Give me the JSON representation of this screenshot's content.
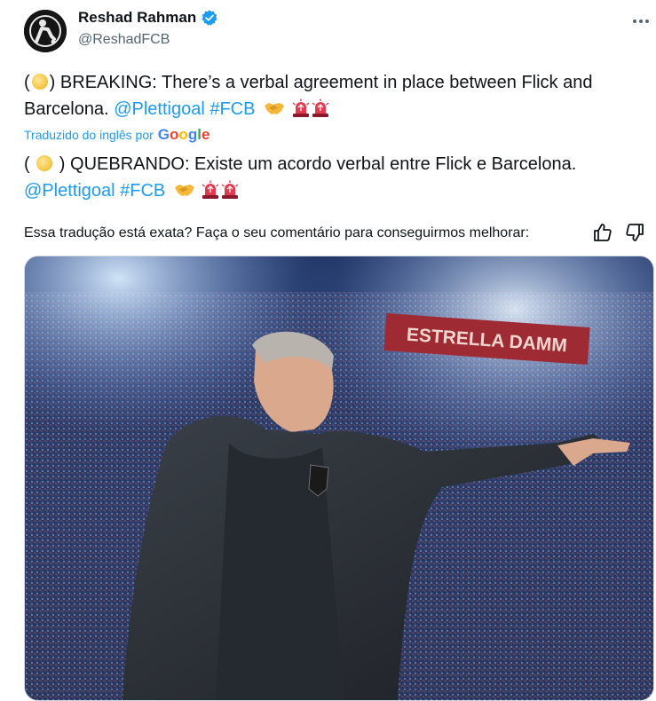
{
  "author": {
    "name": "Reshad Rahman",
    "handle": "@ReshadFCB"
  },
  "tweet": {
    "open_paren": "(",
    "close_paren": ")",
    "body": "BREAKING: There’s a verbal agreement in place between Flick and Barcelona.",
    "mention": "@Plettigoal",
    "hashtag": "#FCB"
  },
  "translation": {
    "translated_by": "Traduzido do inglês por",
    "provider": "Google",
    "open_paren": "(",
    "close_paren": ")",
    "body": "QUEBRANDO: Existe um acordo verbal entre Flick e Barcelona.",
    "mention": "@Plettigoal",
    "hashtag": "#FCB"
  },
  "feedback": {
    "prompt": "Essa tradução está exata? Faça o seu comentário para conseguirmos melhorar:"
  },
  "media": {
    "banner_text": "ESTRELLA DAMM"
  },
  "colors": {
    "link": "#1d9bf0",
    "verified": "#1d9bf0",
    "secondary_text": "#536471"
  },
  "icons": [
    "more-icon",
    "verified-badge-icon",
    "sun-emoji-icon",
    "handshake-emoji-icon",
    "siren-emoji-icon",
    "thumbs-up-icon",
    "thumbs-down-icon"
  ]
}
